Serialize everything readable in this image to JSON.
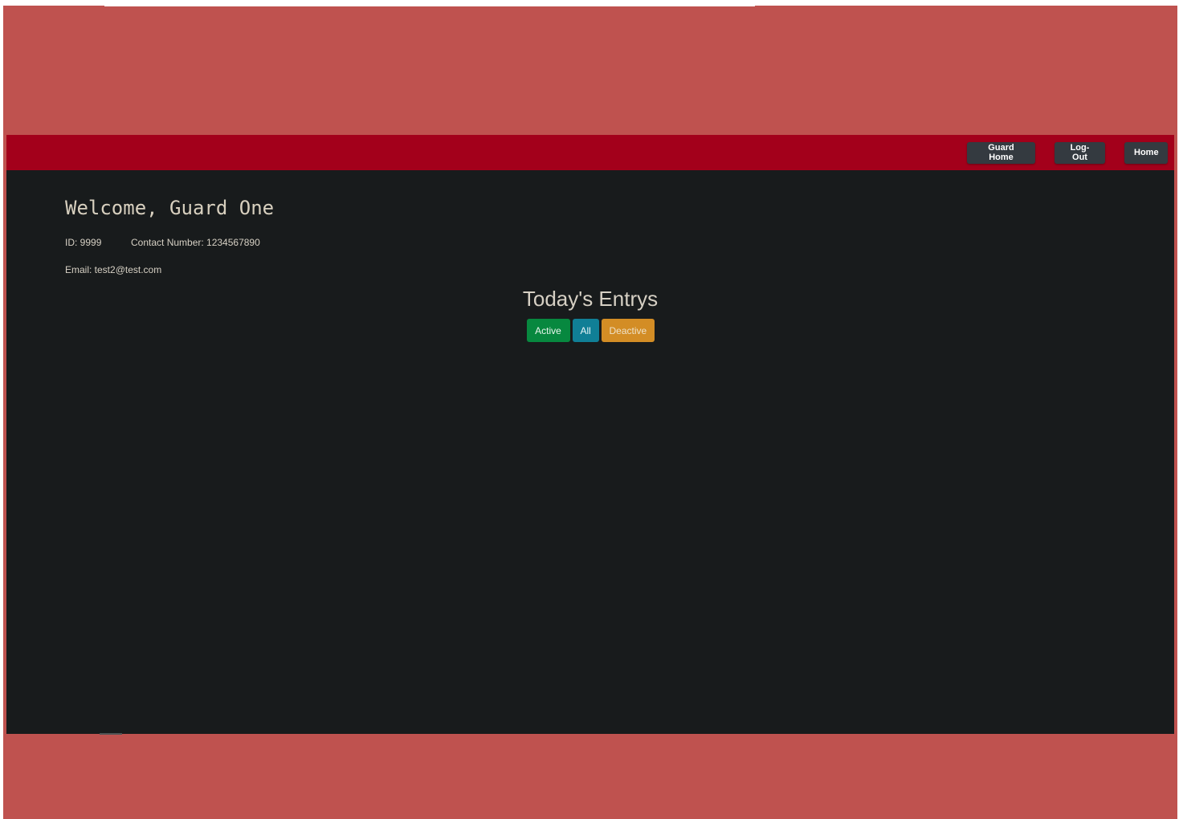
{
  "nav": {
    "buttons": [
      {
        "label": "Guard Home"
      },
      {
        "label": "Log-Out"
      },
      {
        "label": "Home"
      }
    ]
  },
  "profile": {
    "welcome": "Welcome, Guard One",
    "id_text": "ID: 9999",
    "contact_text": "Contact Number: 1234567890",
    "email_text": "Email: test2@test.com"
  },
  "entries": {
    "title": "Today's Entrys",
    "filters": [
      {
        "label": "Active"
      },
      {
        "label": "All"
      },
      {
        "label": "Deactive"
      }
    ]
  },
  "colors": {
    "frame": "#bf524f",
    "navbar": "#a3001b",
    "content": "#181b1c",
    "active": "#07883f",
    "all": "#107f96",
    "deactive": "#d38d25"
  }
}
